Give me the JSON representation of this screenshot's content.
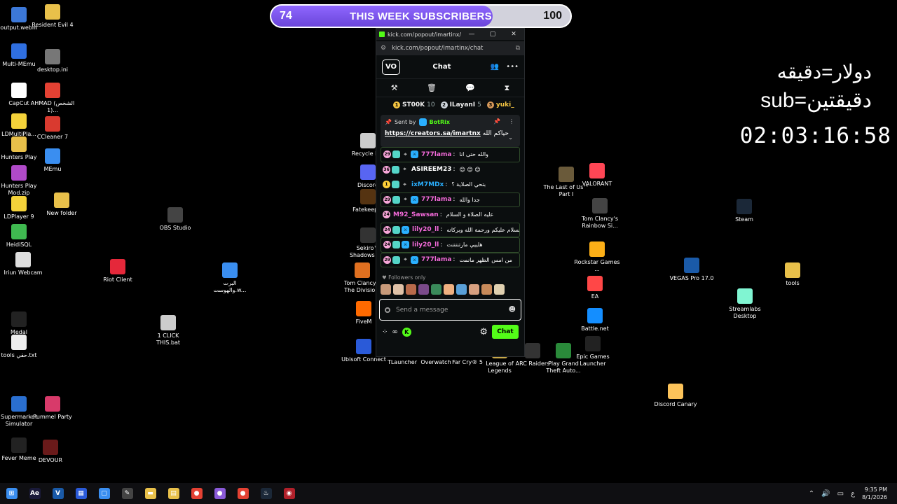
{
  "desktop": {
    "icons": [
      {
        "label": "output.webm",
        "color": "#3c78d8"
      },
      {
        "label": "Resident Evil 4",
        "color": "#e8c04a"
      },
      {
        "label": "Multi-MEmu",
        "color": "#2f6fe0"
      },
      {
        "label": "desktop.ini",
        "color": "#777777"
      },
      {
        "label": "CapCut",
        "color": "#ffffff"
      },
      {
        "label": "AHMAD (الشخص 1)...",
        "color": "#e44133"
      },
      {
        "label": "LDMultiPla...",
        "color": "#f4d23a"
      },
      {
        "label": "CCleaner 7",
        "color": "#d93a2f"
      },
      {
        "label": "Hunters Play",
        "color": "#e8c04a"
      },
      {
        "label": "MEmu",
        "color": "#3a8ef0"
      },
      {
        "label": "Hunters Play Mod.zip",
        "color": "#b04ac8"
      },
      {
        "label": "LDPlayer 9",
        "color": "#f4d23a"
      },
      {
        "label": "New folder",
        "color": "#e8c04a"
      },
      {
        "label": "HeidiSQL",
        "color": "#3fb950"
      },
      {
        "label": "OBS Studio",
        "color": "#444444"
      },
      {
        "label": "Iriun Webcam",
        "color": "#dddddd"
      },
      {
        "label": "Riot Client",
        "color": "#e5283a"
      },
      {
        "label": "البرت والهوست.w...",
        "color": "#3a8ef0"
      },
      {
        "label": "Medal",
        "color": "#222222"
      },
      {
        "label": "1 CLICK THIS.bat",
        "color": "#cccccc"
      },
      {
        "label": "tools حقي.txt",
        "color": "#eeeeee"
      },
      {
        "label": "Supermarket Simulator",
        "color": "#2a6fd0"
      },
      {
        "label": "Pummel Party",
        "color": "#d83a6a"
      },
      {
        "label": "Fever Meme",
        "color": "#222222"
      },
      {
        "label": "DEVOUR",
        "color": "#6a1a1a"
      },
      {
        "label": "Recycle B...",
        "color": "#cccccc"
      },
      {
        "label": "Discord",
        "color": "#5865f2"
      },
      {
        "label": "Fatekeep...",
        "color": "#553311"
      },
      {
        "label": "Sekiro™ Shadows D...",
        "color": "#333333"
      },
      {
        "label": "Tom Clancy's The Divisio...",
        "color": "#e07020"
      },
      {
        "label": "FiveM",
        "color": "#ff6a00"
      },
      {
        "label": "Ubisoft Connect",
        "color": "#2a5ad8"
      },
      {
        "label": "TLauncher",
        "color": "#333333"
      },
      {
        "label": "Overwatch",
        "color": "#f99e1a"
      },
      {
        "label": "Far Cry® 5",
        "color": "#b43a2a"
      },
      {
        "label": "League of Legends",
        "color": "#c8a94a"
      },
      {
        "label": "ARC Raiders",
        "color": "#333333"
      },
      {
        "label": "Play Grand Theft Auto...",
        "color": "#2a8a3a"
      },
      {
        "label": "Epic Games Launcher",
        "color": "#222222"
      },
      {
        "label": "The Last of Us™ Part I",
        "color": "#6a5a3a"
      },
      {
        "label": "VALORANT",
        "color": "#ff4655"
      },
      {
        "label": "Tom Clancy's Rainbow Si...",
        "color": "#444444"
      },
      {
        "label": "Rockstar Games ...",
        "color": "#fcaf17"
      },
      {
        "label": "EA",
        "color": "#ff4747"
      },
      {
        "label": "Battle.net",
        "color": "#148eff"
      },
      {
        "label": "VEGAS Pro 17.0",
        "color": "#1a5aa8"
      },
      {
        "label": "Steam",
        "color": "#1b2838"
      },
      {
        "label": "tools",
        "color": "#e8c04a"
      },
      {
        "label": "Streamlabs Desktop",
        "color": "#80f5d2"
      },
      {
        "label": "Discord Canary",
        "color": "#fcc35a"
      }
    ]
  },
  "subscribers": {
    "current": "74",
    "goal": "100",
    "title": "THIS WEEK SUBSCRIBERS",
    "progress_fraction": 0.74
  },
  "overlay": {
    "line1": "دولار=دقيقه",
    "line2": "sub=دقيقتين",
    "timer": "02:03:16:58"
  },
  "browser": {
    "window_title": "kick.com/popout/imartinx/...",
    "url": "kick.com/popout/imartinx/chat"
  },
  "chat": {
    "logo_text": "VO",
    "title": "Chat",
    "leaderboard": [
      {
        "rank": "1",
        "name": "ST00K",
        "count": "10",
        "color": "#f5c542"
      },
      {
        "rank": "2",
        "name": "ILayanI",
        "count": "5",
        "color": "#cfd6dd"
      },
      {
        "rank": "3",
        "name": "yuki_",
        "count": "",
        "color": "#d89a5a"
      }
    ],
    "pinned": {
      "sent_by_label": "Sent by",
      "bot_name": "BotRix",
      "message_prefix": "حياكم الله",
      "link": "https://creators.sa/imartnx"
    },
    "messages": [
      {
        "badge": "29",
        "username": "777lama",
        "color": "#f36ad9",
        "text": "والله حتى انا",
        "highlight": true,
        "badges": [
          "sub",
          "gift",
          "og",
          "mod"
        ]
      },
      {
        "badge": "36",
        "username": "ASIREEM23",
        "color": "#ffffff",
        "text": "😊 😊 😊",
        "highlight": false,
        "badges": [
          "sub",
          "gift",
          "og"
        ]
      },
      {
        "badge": "1",
        "username": "ixM7MDx",
        "color": "#2ab0ff",
        "text": "بتحي الصلاية ؟",
        "highlight": false,
        "badges": [
          "vip",
          "gift",
          "og"
        ]
      },
      {
        "badge": "29",
        "username": "777lama",
        "color": "#f36ad9",
        "text": "جدا والله",
        "highlight": true,
        "badges": [
          "sub",
          "gift",
          "og",
          "mod"
        ]
      },
      {
        "badge": "24",
        "username": "M92_Sawsan",
        "color": "#f36ad9",
        "text": "عليه الصلاة و السلام",
        "highlight": false,
        "badges": [
          "sub"
        ]
      },
      {
        "badge": "24",
        "username": "lily20_ll",
        "color": "#f36ad9",
        "text": "السلام عليكم ورحمة الله وبركاته",
        "highlight": true,
        "badges": [
          "sub",
          "gift",
          "mod"
        ]
      },
      {
        "badge": "24",
        "username": "lily20_ll",
        "color": "#f36ad9",
        "text": "هلييي مارتننننت",
        "highlight": true,
        "badges": [
          "sub",
          "gift",
          "mod"
        ]
      },
      {
        "badge": "29",
        "username": "777lama",
        "color": "#f36ad9",
        "text": "من امس الظهر مانمت",
        "highlight": true,
        "badges": [
          "sub",
          "gift",
          "og",
          "mod"
        ]
      }
    ],
    "followers_label": "Followers only",
    "emote_colors": [
      "#c89a7a",
      "#e0c2a8",
      "#b86a4a",
      "#7a4a8a",
      "#3a8a5a",
      "#f0b080",
      "#5aa0d8",
      "#d8a080",
      "#c88a5a",
      "#e0d0b0"
    ],
    "input_placeholder": "Send a message",
    "points_label": "∞",
    "send_label": "Chat"
  },
  "taskbar": {
    "items": [
      {
        "name": "windows-start-icon",
        "glyph": "⊞",
        "color": "#3a8ef0"
      },
      {
        "name": "after-effects-icon",
        "glyph": "Ae",
        "color": "#1a1a3a"
      },
      {
        "name": "vegas-icon",
        "glyph": "V",
        "color": "#1a5aa8"
      },
      {
        "name": "calculator-icon",
        "glyph": "▦",
        "color": "#2a5ad8"
      },
      {
        "name": "window-icon",
        "glyph": "▢",
        "color": "#3a8ef0"
      },
      {
        "name": "tool-icon",
        "glyph": "✎",
        "color": "#444444"
      },
      {
        "name": "file-explorer-icon",
        "glyph": "▬",
        "color": "#e8c04a"
      },
      {
        "name": "store-icon",
        "glyph": "▤",
        "color": "#e8c04a"
      },
      {
        "name": "chrome-icon",
        "glyph": "●",
        "color": "#e44133"
      },
      {
        "name": "obs-chrome-icon",
        "glyph": "●",
        "color": "#8a5ad8"
      },
      {
        "name": "chrome-active-icon",
        "glyph": "●",
        "color": "#e44133"
      },
      {
        "name": "steam-icon",
        "glyph": "♨",
        "color": "#1b2838"
      },
      {
        "name": "obs-icon",
        "glyph": "◉",
        "color": "#b0202a"
      }
    ],
    "tray_lang": "ع",
    "time": "9:35 PM",
    "date": "8/1/2026"
  }
}
